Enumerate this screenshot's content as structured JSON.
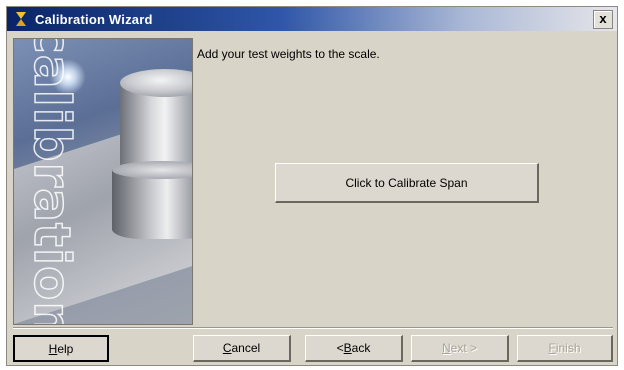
{
  "window": {
    "title": "Calibration Wizard",
    "close_glyph": "x"
  },
  "side_panel": {
    "word": "calibration"
  },
  "content": {
    "instruction": "Add your test weights to the scale.",
    "calibrate_button": "Click to Calibrate Span"
  },
  "footer": {
    "help": {
      "prefix": "",
      "mnemonic": "H",
      "suffix": "elp",
      "enabled": true
    },
    "cancel": {
      "prefix": "",
      "mnemonic": "C",
      "suffix": "ancel",
      "enabled": true
    },
    "back": {
      "prefix": "< ",
      "mnemonic": "B",
      "suffix": "ack",
      "enabled": true
    },
    "next": {
      "prefix": "",
      "mnemonic": "N",
      "suffix": "ext >",
      "enabled": false
    },
    "finish": {
      "prefix": "",
      "mnemonic": "F",
      "suffix": "inish",
      "enabled": false
    }
  },
  "colors": {
    "title_gradient_start": "#0a2466",
    "dialog_background": "#d8d4c8",
    "disabled_text": "#a8a49a"
  },
  "icons": {
    "title": "hourglass-icon",
    "close": "close-icon"
  }
}
